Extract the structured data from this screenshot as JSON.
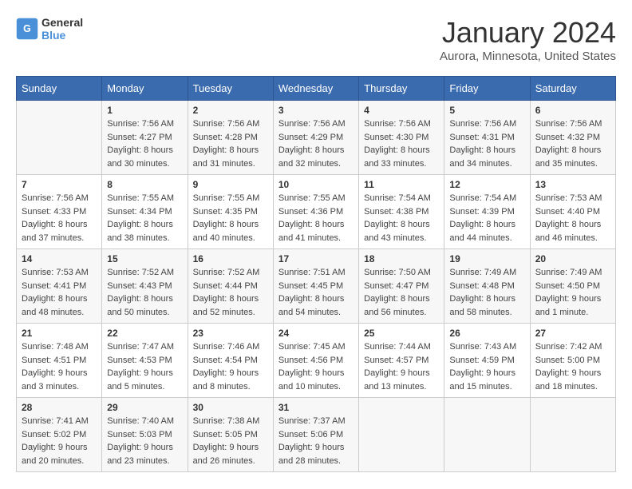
{
  "header": {
    "logo_line1": "General",
    "logo_line2": "Blue",
    "month_title": "January 2024",
    "location": "Aurora, Minnesota, United States"
  },
  "weekdays": [
    "Sunday",
    "Monday",
    "Tuesday",
    "Wednesday",
    "Thursday",
    "Friday",
    "Saturday"
  ],
  "weeks": [
    [
      {
        "day": "",
        "info": ""
      },
      {
        "day": "1",
        "info": "Sunrise: 7:56 AM\nSunset: 4:27 PM\nDaylight: 8 hours\nand 30 minutes."
      },
      {
        "day": "2",
        "info": "Sunrise: 7:56 AM\nSunset: 4:28 PM\nDaylight: 8 hours\nand 31 minutes."
      },
      {
        "day": "3",
        "info": "Sunrise: 7:56 AM\nSunset: 4:29 PM\nDaylight: 8 hours\nand 32 minutes."
      },
      {
        "day": "4",
        "info": "Sunrise: 7:56 AM\nSunset: 4:30 PM\nDaylight: 8 hours\nand 33 minutes."
      },
      {
        "day": "5",
        "info": "Sunrise: 7:56 AM\nSunset: 4:31 PM\nDaylight: 8 hours\nand 34 minutes."
      },
      {
        "day": "6",
        "info": "Sunrise: 7:56 AM\nSunset: 4:32 PM\nDaylight: 8 hours\nand 35 minutes."
      }
    ],
    [
      {
        "day": "7",
        "info": "Sunrise: 7:56 AM\nSunset: 4:33 PM\nDaylight: 8 hours\nand 37 minutes."
      },
      {
        "day": "8",
        "info": "Sunrise: 7:55 AM\nSunset: 4:34 PM\nDaylight: 8 hours\nand 38 minutes."
      },
      {
        "day": "9",
        "info": "Sunrise: 7:55 AM\nSunset: 4:35 PM\nDaylight: 8 hours\nand 40 minutes."
      },
      {
        "day": "10",
        "info": "Sunrise: 7:55 AM\nSunset: 4:36 PM\nDaylight: 8 hours\nand 41 minutes."
      },
      {
        "day": "11",
        "info": "Sunrise: 7:54 AM\nSunset: 4:38 PM\nDaylight: 8 hours\nand 43 minutes."
      },
      {
        "day": "12",
        "info": "Sunrise: 7:54 AM\nSunset: 4:39 PM\nDaylight: 8 hours\nand 44 minutes."
      },
      {
        "day": "13",
        "info": "Sunrise: 7:53 AM\nSunset: 4:40 PM\nDaylight: 8 hours\nand 46 minutes."
      }
    ],
    [
      {
        "day": "14",
        "info": "Sunrise: 7:53 AM\nSunset: 4:41 PM\nDaylight: 8 hours\nand 48 minutes."
      },
      {
        "day": "15",
        "info": "Sunrise: 7:52 AM\nSunset: 4:43 PM\nDaylight: 8 hours\nand 50 minutes."
      },
      {
        "day": "16",
        "info": "Sunrise: 7:52 AM\nSunset: 4:44 PM\nDaylight: 8 hours\nand 52 minutes."
      },
      {
        "day": "17",
        "info": "Sunrise: 7:51 AM\nSunset: 4:45 PM\nDaylight: 8 hours\nand 54 minutes."
      },
      {
        "day": "18",
        "info": "Sunrise: 7:50 AM\nSunset: 4:47 PM\nDaylight: 8 hours\nand 56 minutes."
      },
      {
        "day": "19",
        "info": "Sunrise: 7:49 AM\nSunset: 4:48 PM\nDaylight: 8 hours\nand 58 minutes."
      },
      {
        "day": "20",
        "info": "Sunrise: 7:49 AM\nSunset: 4:50 PM\nDaylight: 9 hours\nand 1 minute."
      }
    ],
    [
      {
        "day": "21",
        "info": "Sunrise: 7:48 AM\nSunset: 4:51 PM\nDaylight: 9 hours\nand 3 minutes."
      },
      {
        "day": "22",
        "info": "Sunrise: 7:47 AM\nSunset: 4:53 PM\nDaylight: 9 hours\nand 5 minutes."
      },
      {
        "day": "23",
        "info": "Sunrise: 7:46 AM\nSunset: 4:54 PM\nDaylight: 9 hours\nand 8 minutes."
      },
      {
        "day": "24",
        "info": "Sunrise: 7:45 AM\nSunset: 4:56 PM\nDaylight: 9 hours\nand 10 minutes."
      },
      {
        "day": "25",
        "info": "Sunrise: 7:44 AM\nSunset: 4:57 PM\nDaylight: 9 hours\nand 13 minutes."
      },
      {
        "day": "26",
        "info": "Sunrise: 7:43 AM\nSunset: 4:59 PM\nDaylight: 9 hours\nand 15 minutes."
      },
      {
        "day": "27",
        "info": "Sunrise: 7:42 AM\nSunset: 5:00 PM\nDaylight: 9 hours\nand 18 minutes."
      }
    ],
    [
      {
        "day": "28",
        "info": "Sunrise: 7:41 AM\nSunset: 5:02 PM\nDaylight: 9 hours\nand 20 minutes."
      },
      {
        "day": "29",
        "info": "Sunrise: 7:40 AM\nSunset: 5:03 PM\nDaylight: 9 hours\nand 23 minutes."
      },
      {
        "day": "30",
        "info": "Sunrise: 7:38 AM\nSunset: 5:05 PM\nDaylight: 9 hours\nand 26 minutes."
      },
      {
        "day": "31",
        "info": "Sunrise: 7:37 AM\nSunset: 5:06 PM\nDaylight: 9 hours\nand 28 minutes."
      },
      {
        "day": "",
        "info": ""
      },
      {
        "day": "",
        "info": ""
      },
      {
        "day": "",
        "info": ""
      }
    ]
  ]
}
